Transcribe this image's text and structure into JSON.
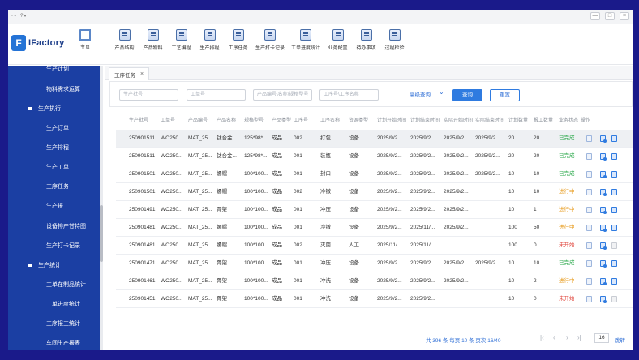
{
  "titlebar": {
    "menu": [
      "◦",
      "?"
    ],
    "buttons": [
      "—",
      "□",
      "×"
    ]
  },
  "logo": {
    "mark": "F",
    "text": "IFactory"
  },
  "home_label": "主页",
  "toolbar_items": [
    "产品结构",
    "产品物料",
    "工艺编程",
    "生产排程",
    "工序任务",
    "生产打卡记录",
    "工单进度统计",
    "业务配置",
    "待办事项",
    "过程检验"
  ],
  "sidebar": {
    "items": [
      {
        "label": "生产计划",
        "type": "sub"
      },
      {
        "label": "物料需求运算",
        "type": "sub"
      },
      {
        "label": "生产执行",
        "type": "group"
      },
      {
        "label": "生产订单",
        "type": "sub"
      },
      {
        "label": "生产排程",
        "type": "sub"
      },
      {
        "label": "生产工单",
        "type": "sub"
      },
      {
        "label": "工序任务",
        "type": "sub"
      },
      {
        "label": "生产报工",
        "type": "sub"
      },
      {
        "label": "设备排产甘特图",
        "type": "sub"
      },
      {
        "label": "生产打卡记录",
        "type": "sub"
      },
      {
        "label": "生产统计",
        "type": "group"
      },
      {
        "label": "工单在制品统计",
        "type": "sub"
      },
      {
        "label": "工单进度统计",
        "type": "sub"
      },
      {
        "label": "工序报工统计",
        "type": "sub"
      },
      {
        "label": "车间生产报表",
        "type": "sub"
      }
    ]
  },
  "tab": {
    "label": "工序任务",
    "close": "×"
  },
  "filters": {
    "batch_placeholder": "生产批号",
    "order_placeholder": "工单号",
    "product_placeholder": "产品编号\\名称\\规格型号",
    "process_placeholder": "工序号\\工序名称",
    "advanced": "高级查询",
    "advanced_chevron": "⌄",
    "search": "查询",
    "reset": "重置"
  },
  "table": {
    "headers": [
      "生产批号",
      "工单号",
      "产品编号",
      "产品名称",
      "规格型号",
      "产品类型",
      "工序号",
      "工序名称",
      "资源类型",
      "计划开始时间",
      "计划结束时间",
      "实际开始时间",
      "实际结束时间",
      "计划数量",
      "报工数量",
      "业务状态",
      "操作"
    ],
    "rows": [
      [
        "250901511",
        "WO250...",
        "MAT_25...",
        "钛合金...",
        "125*98*...",
        "成品",
        "002",
        "打包",
        "设备",
        "2025/9/2...",
        "2025/9/2...",
        "2025/9/2...",
        "2025/9/2...",
        "20",
        "20",
        "已完成"
      ],
      [
        "250901511",
        "WO250...",
        "MAT_25...",
        "钛合金...",
        "125*98*...",
        "成品",
        "001",
        "装瓶",
        "设备",
        "2025/9/2...",
        "2025/9/2...",
        "2025/9/2...",
        "2025/9/2...",
        "20",
        "20",
        "已完成"
      ],
      [
        "250901501",
        "WO250...",
        "MAT_25...",
        "螺帽",
        "100*100...",
        "成品",
        "001",
        "封口",
        "设备",
        "2025/9/2...",
        "2025/9/2...",
        "2025/9/2...",
        "2025/9/2...",
        "10",
        "10",
        "已完成"
      ],
      [
        "250901501",
        "WO250...",
        "MAT_25...",
        "螺帽",
        "100*100...",
        "成品",
        "002",
        "冷镦",
        "设备",
        "2025/9/2...",
        "2025/9/2...",
        "2025/9/2...",
        "",
        "10",
        "10",
        "进行中"
      ],
      [
        "250901491",
        "WO250...",
        "MAT_25...",
        "骨架",
        "100*100...",
        "成品",
        "001",
        "冲压",
        "设备",
        "2025/9/2...",
        "2025/9/2...",
        "2025/9/2...",
        "",
        "10",
        "1",
        "进行中"
      ],
      [
        "250901481",
        "WO250...",
        "MAT_25...",
        "螺帽",
        "100*100...",
        "成品",
        "001",
        "冷镦",
        "设备",
        "2025/9/2...",
        "2025/11/...",
        "2025/9/2...",
        "",
        "100",
        "50",
        "进行中"
      ],
      [
        "250901481",
        "WO250...",
        "MAT_25...",
        "螺帽",
        "100*100...",
        "成品",
        "002",
        "灭菌",
        "人工",
        "2025/11/...",
        "2025/11/...",
        "",
        "",
        "100",
        "0",
        "未开始"
      ],
      [
        "250901471",
        "WO250...",
        "MAT_25...",
        "骨架",
        "100*100...",
        "成品",
        "001",
        "冲压",
        "设备",
        "2025/9/2...",
        "2025/9/2...",
        "2025/9/2...",
        "2025/9/2...",
        "10",
        "10",
        "已完成"
      ],
      [
        "250901461",
        "WO250...",
        "MAT_25...",
        "骨架",
        "100*100...",
        "成品",
        "001",
        "冲洗",
        "设备",
        "2025/9/2...",
        "2025/9/2...",
        "2025/9/2...",
        "",
        "10",
        "2",
        "进行中"
      ],
      [
        "250901451",
        "WO250...",
        "MAT_25...",
        "骨架",
        "100*100...",
        "成品",
        "001",
        "冲洗",
        "设备",
        "2025/9/2...",
        "2025/9/2...",
        "",
        "",
        "10",
        "0",
        "未开始"
      ]
    ],
    "action_icons": [
      "view-icon",
      "edit-icon",
      "assign-icon"
    ]
  },
  "pager": {
    "info": "共 396 条  每页 10 条  页次 16/40",
    "first": "|‹",
    "prev": "‹",
    "next": "›",
    "last": "›|",
    "page_value": "16",
    "go": "跳转"
  },
  "colors": {
    "sidebar": "#1b3fa3",
    "primary": "#2f7be0",
    "done": "#2aa84a",
    "doing": "#e79a1b",
    "todo": "#e0463d"
  }
}
